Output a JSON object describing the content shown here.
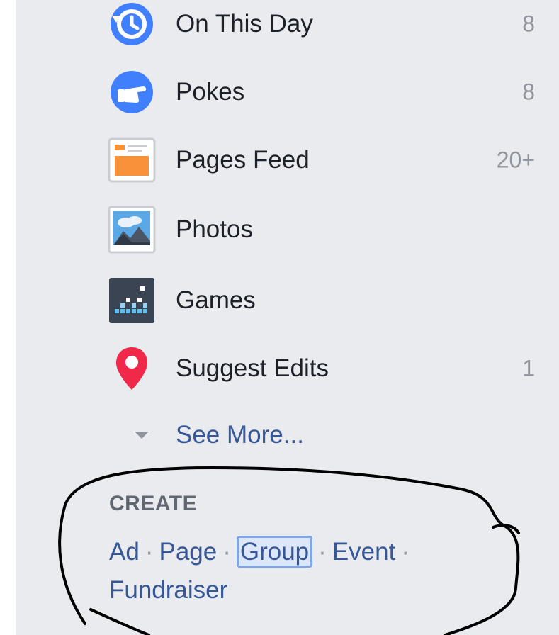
{
  "sidebar": {
    "items": [
      {
        "label": "On This Day",
        "count": "8",
        "icon": "on-this-day-icon"
      },
      {
        "label": "Pokes",
        "count": "8",
        "icon": "pokes-icon"
      },
      {
        "label": "Pages Feed",
        "count": "20+",
        "icon": "pages-feed-icon"
      },
      {
        "label": "Photos",
        "count": "",
        "icon": "photos-icon"
      },
      {
        "label": "Games",
        "count": "",
        "icon": "games-icon"
      },
      {
        "label": "Suggest Edits",
        "count": "1",
        "icon": "map-pin-icon"
      }
    ],
    "see_more": {
      "label": "See More...",
      "icon": "chevron-down-icon"
    }
  },
  "create": {
    "heading": "CREATE",
    "links": {
      "ad": "Ad",
      "page": "Page",
      "group": "Group",
      "event": "Event",
      "fundraiser": "Fundraiser"
    },
    "separator": "·"
  },
  "colors": {
    "background": "#e9ebee",
    "link": "#365899",
    "text": "#1d2129",
    "muted": "#90949c",
    "focus_border": "#7fa6e8",
    "pin_red": "#f02849",
    "facebook_blue": "#4080ff"
  }
}
